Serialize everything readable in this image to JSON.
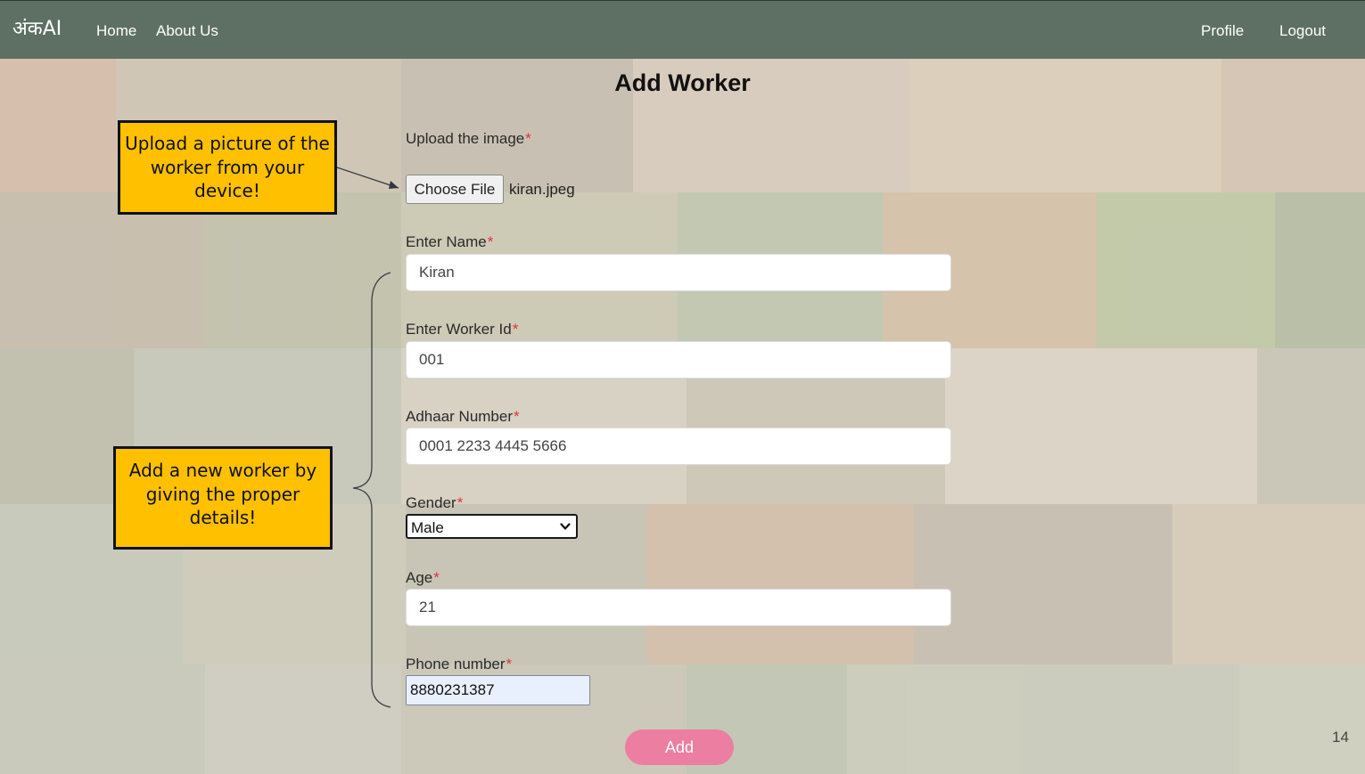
{
  "navbar": {
    "brand": "अंकAI",
    "links": {
      "home": "Home",
      "about": "About Us"
    },
    "right": {
      "profile": "Profile",
      "logout": "Logout"
    }
  },
  "form": {
    "title": "Add Worker",
    "upload": {
      "label": "Upload the image",
      "required_mark": "*",
      "button_label": "Choose File",
      "file_name": "kiran.jpeg"
    },
    "name": {
      "label": "Enter Name",
      "required_mark": "*",
      "value": "Kiran"
    },
    "worker_id": {
      "label": "Enter Worker Id",
      "required_mark": "*",
      "value": "001"
    },
    "adhaar": {
      "label": "Adhaar Number",
      "required_mark": "*",
      "value": "0001 2233 4445 5666"
    },
    "gender": {
      "label": "Gender",
      "required_mark": "*",
      "selected": "Male"
    },
    "age": {
      "label": "Age",
      "required_mark": "*",
      "value": "21"
    },
    "phone": {
      "label": "Phone number",
      "required_mark": "*",
      "value": "8880231387"
    },
    "submit_label": "Add"
  },
  "callouts": {
    "upload": "Upload a picture of the worker from your device!",
    "add": "Add a new worker by giving the proper details!"
  },
  "page_number": "14",
  "colors": {
    "navbar": "#5e7063",
    "callout": "#ffc000",
    "add_button": "#ec7ea1",
    "required": "#e0343b"
  },
  "icons": {
    "select_arrow": "chevron-down-icon"
  }
}
